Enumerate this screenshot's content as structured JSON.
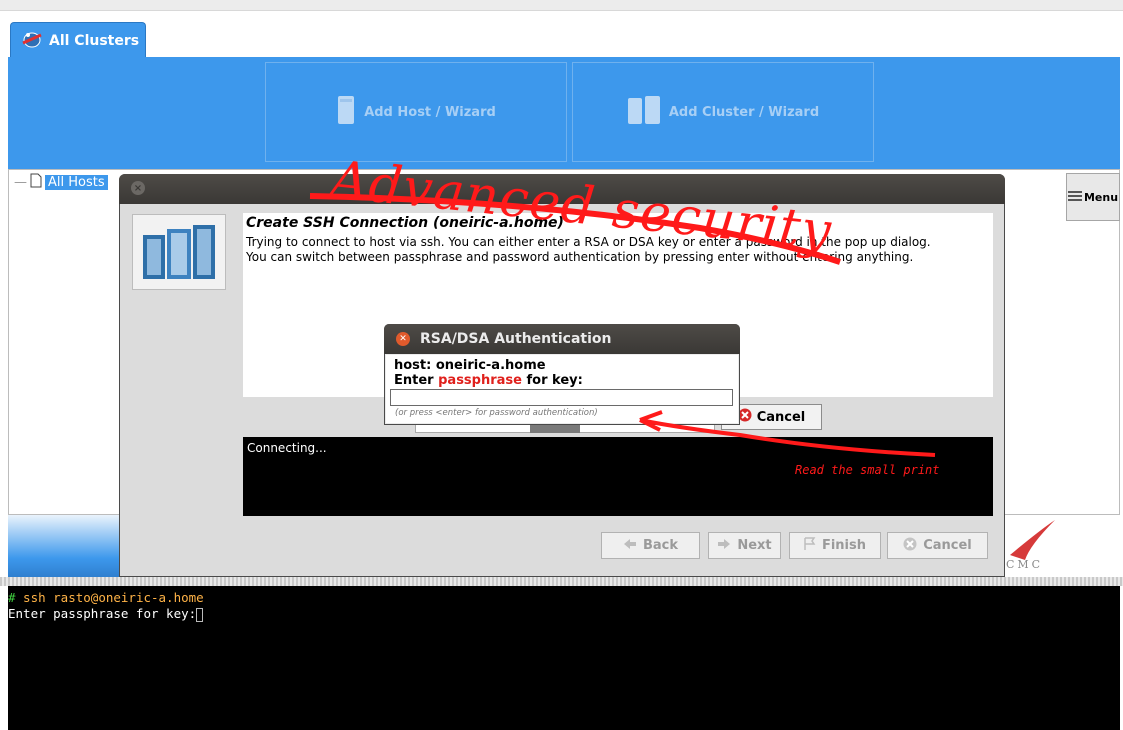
{
  "tabs": {
    "all_clusters": "All Clusters"
  },
  "wizards": {
    "add_host": "Add Host / Wizard",
    "add_cluster": "Add Cluster / Wizard"
  },
  "tree": {
    "root_label": "All Hosts"
  },
  "menu": {
    "label": "Menu"
  },
  "brand": {
    "text": "CMC"
  },
  "dialog": {
    "heading": "Create SSH Connection (oneiric-a.home)",
    "line1": "Trying to connect to host via ssh. You can either enter a RSA or DSA key or enter a password in the pop up dialog.",
    "line2": "You can switch between passphrase and password authentication by pressing enter without entering anything.",
    "log": "Connecting...",
    "cancel_connect": "Cancel",
    "buttons": {
      "back": "Back",
      "next": "Next",
      "finish": "Finish",
      "cancel": "Cancel"
    }
  },
  "rsa_dialog": {
    "title": "RSA/DSA Authentication",
    "host_line": "host: oneiric-a.home",
    "prompt_before": "Enter ",
    "prompt_highlight": "passphrase",
    "prompt_after": " for key:",
    "input_value": "",
    "hint": "(or press <enter> for password authentication)"
  },
  "terminal": {
    "line1_prompt": "#",
    "line1_cmd": " ssh rasto@oneiric-a.home",
    "line2": "Enter passphrase for key:"
  },
  "annotations": {
    "big": "Advanced security",
    "small": "Read the small print"
  },
  "colors": {
    "accent_blue": "#3d98ec",
    "annotation_red": "#ff1a1a",
    "terminal_green": "#3fd13f",
    "terminal_orange": "#ffb347"
  }
}
